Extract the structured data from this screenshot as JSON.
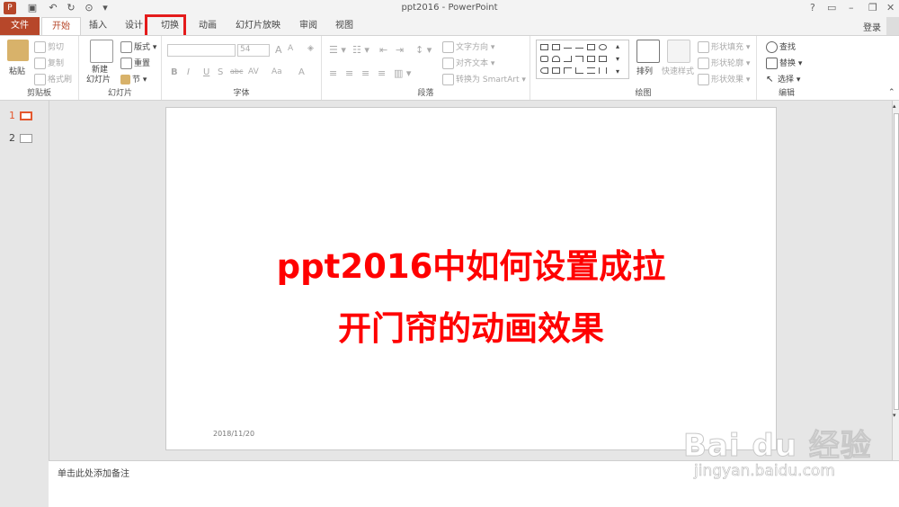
{
  "window": {
    "title": "ppt2016 - PowerPoint",
    "help": "?",
    "login": "登录"
  },
  "tabs": [
    "文件",
    "开始",
    "插入",
    "设计",
    "切换",
    "动画",
    "幻灯片放映",
    "审阅",
    "视图"
  ],
  "ribbon": {
    "clipboard": {
      "label": "剪贴板",
      "paste": "粘贴",
      "cut": "剪切",
      "copy": "复制",
      "format_painter": "格式刷"
    },
    "slides": {
      "label": "幻灯片",
      "new_slide_1": "新建",
      "new_slide_2": "幻灯片",
      "layout": "版式",
      "reset": "重置",
      "section": "节"
    },
    "font": {
      "label": "字体",
      "size": "54",
      "bold": "B",
      "italic": "I",
      "underline": "U",
      "shadow": "S",
      "strike": "abc",
      "spacing": "AV",
      "case": "Aa",
      "color": "A"
    },
    "paragraph": {
      "label": "段落",
      "text_direction": "文字方向",
      "align_text": "对齐文本",
      "smartart": "转换为 SmartArt"
    },
    "drawing": {
      "label": "绘图",
      "arrange": "排列",
      "quick_styles": "快速样式",
      "fill": "形状填充",
      "outline": "形状轮廓",
      "effects": "形状效果"
    },
    "editing": {
      "label": "编辑",
      "find": "查找",
      "replace": "替换",
      "select": "选择"
    }
  },
  "thumbnails": [
    {
      "num": "1"
    },
    {
      "num": "2"
    }
  ],
  "slide": {
    "line1": "ppt2016中如何设置成拉",
    "line2": "开门帘的动画效果",
    "date": "2018/11/20"
  },
  "notes_placeholder": "单击此处添加备注",
  "watermark": {
    "logo": "Bai du 经验",
    "url": "jingyan.baidu.com"
  },
  "colors": {
    "accent": "#b7472a",
    "title_text": "#ff0000",
    "highlight_box": "#e41b1b"
  }
}
